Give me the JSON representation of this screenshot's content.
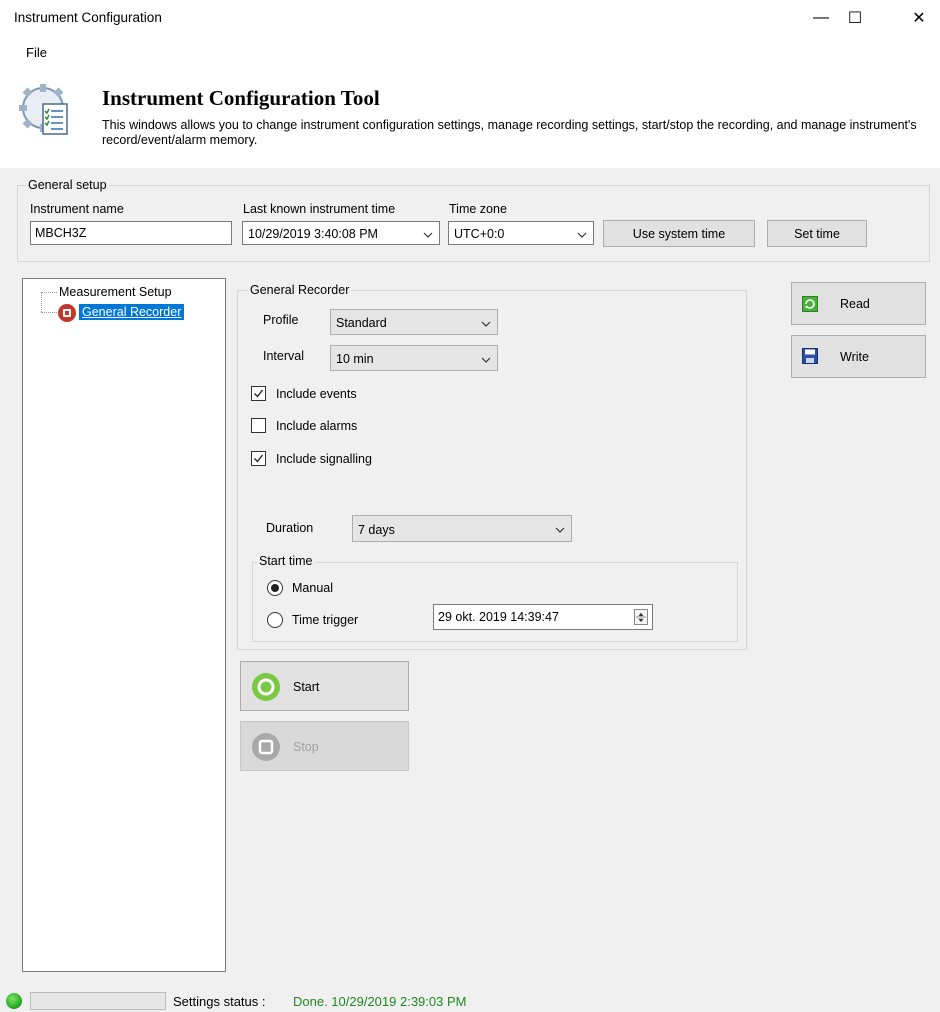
{
  "window": {
    "title": "Instrument Configuration",
    "minimize_glyph": "—",
    "maximize_glyph": "☐",
    "close_glyph": "✕"
  },
  "menu": {
    "file": "File"
  },
  "header": {
    "title": "Instrument Configuration Tool",
    "description": "This windows allows you to change instrument configuration settings, manage recording settings, start/stop the recording, and manage instrument's record/event/alarm memory.",
    "icon": "gear-document-icon"
  },
  "general_setup": {
    "legend": "General setup",
    "instrument_name_label": "Instrument name",
    "instrument_name_value": "MBCH3Z",
    "last_time_label": "Last known instrument time",
    "last_time_value": "10/29/2019 3:40:08 PM",
    "time_zone_label": "Time zone",
    "time_zone_value": "UTC+0:0",
    "use_system_time_button": "Use system time",
    "set_time_button": "Set time"
  },
  "tree": {
    "root": "Measurement Setup",
    "child": "General Recorder"
  },
  "general_recorder": {
    "legend": "General Recorder",
    "profile_label": "Profile",
    "profile_value": "Standard",
    "interval_label": "Interval",
    "interval_value": "10 min",
    "include_events": {
      "label": "Include events",
      "checked": true
    },
    "include_alarms": {
      "label": "Include alarms",
      "checked": false
    },
    "include_signalling": {
      "label": "Include signalling",
      "checked": true
    },
    "duration_label": "Duration",
    "duration_value": "7 days",
    "start_time": {
      "legend": "Start time",
      "manual_label": "Manual",
      "time_trigger_label": "Time trigger",
      "selected": "manual",
      "trigger_datetime": "29 okt. 2019 14:39:47"
    }
  },
  "actions": {
    "read": "Read",
    "write": "Write",
    "start": "Start",
    "stop": "Stop"
  },
  "status": {
    "label": "Settings status :",
    "value": "Done. 10/29/2019 2:39:03 PM"
  },
  "colors": {
    "accent_selection": "#0078d7",
    "status_ok": "#1e8a1e",
    "start_green": "#7ac943",
    "record_red": "#c0392b"
  }
}
